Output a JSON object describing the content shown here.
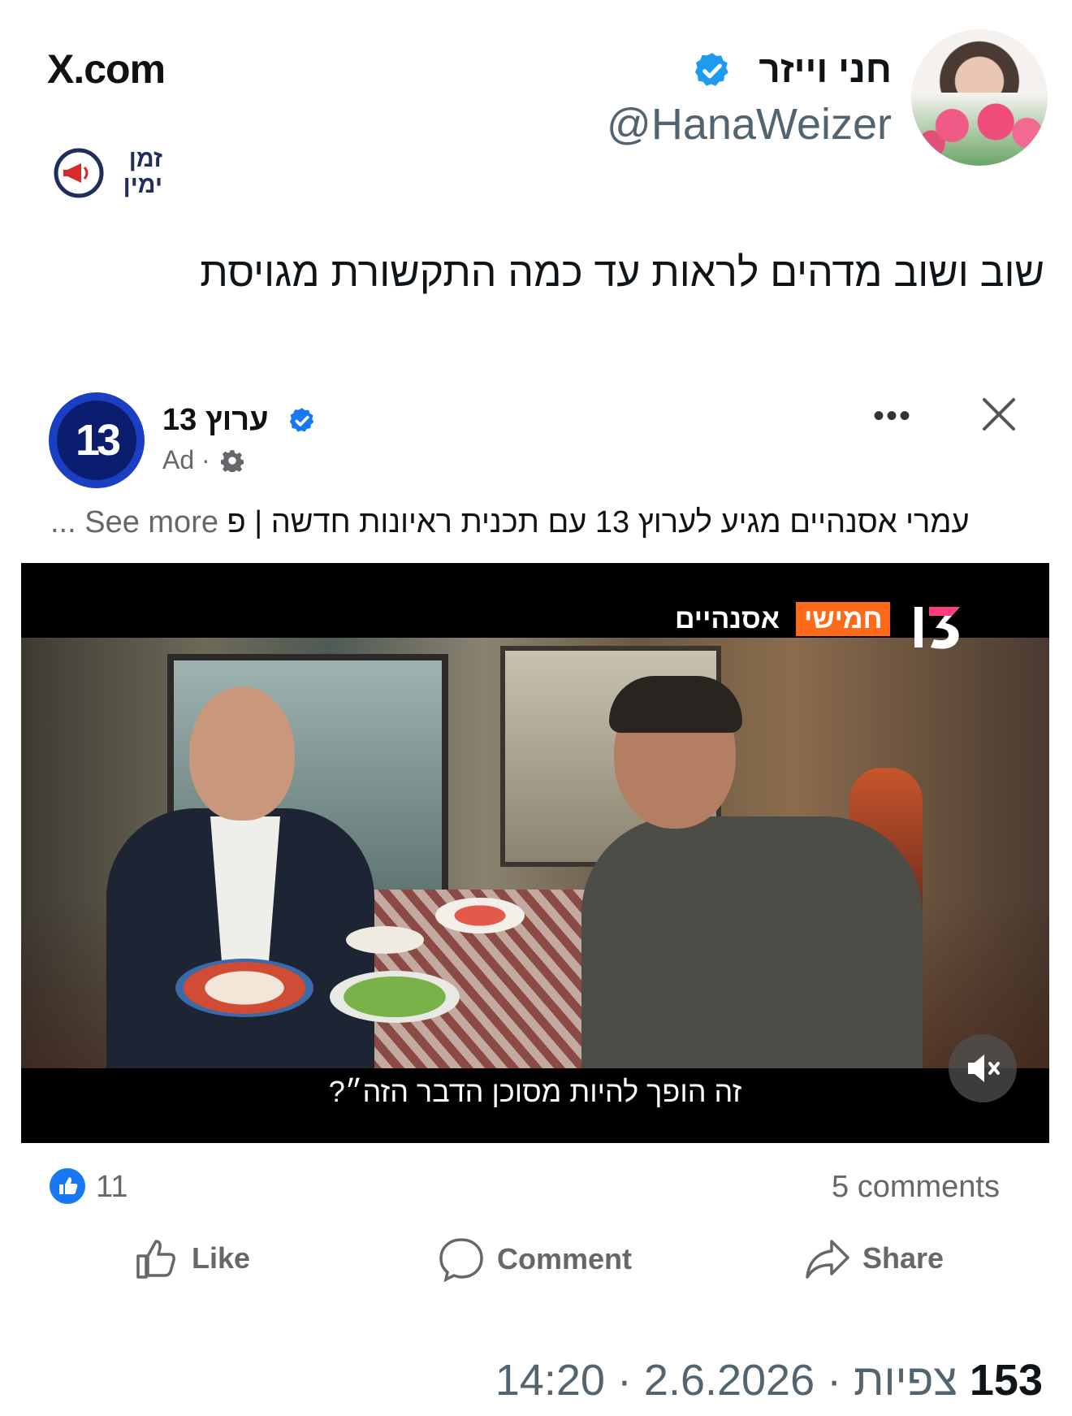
{
  "header": {
    "site": "X.com",
    "author_name": "חני וייזר",
    "handle": "@HanaWeizer",
    "watermark_line1": "זמן",
    "watermark_line2": "ימין"
  },
  "tweet": {
    "text": "שוב ושוב מדהים לראות עד כמה התקשורת מגויסת"
  },
  "embedded_post": {
    "page_name": "ערוץ 13",
    "logo_text": "13",
    "ad_label": "Ad ·",
    "caption": "עמרי אסנהיים מגיע לערוץ 13 עם תכנית ראיונות חדשה | פ",
    "see_more": "... See more",
    "video": {
      "tag_day": "חמישי",
      "tag_show": "אסנהיים",
      "subtitle": "זה הופך להיות מסוכן הדבר הזה״?"
    },
    "likes": "11",
    "comments": "5 comments",
    "actions": {
      "like": "Like",
      "comment": "Comment",
      "share": "Share"
    }
  },
  "footer": {
    "date": "2.6.2026",
    "time": "14:20",
    "views_count": "153",
    "views_label": "צפיות",
    "separator": "·"
  },
  "colors": {
    "verified_blue": "#1d9bf0",
    "fb_blue": "#1877f2",
    "channel_orange": "#ff6a1a"
  }
}
